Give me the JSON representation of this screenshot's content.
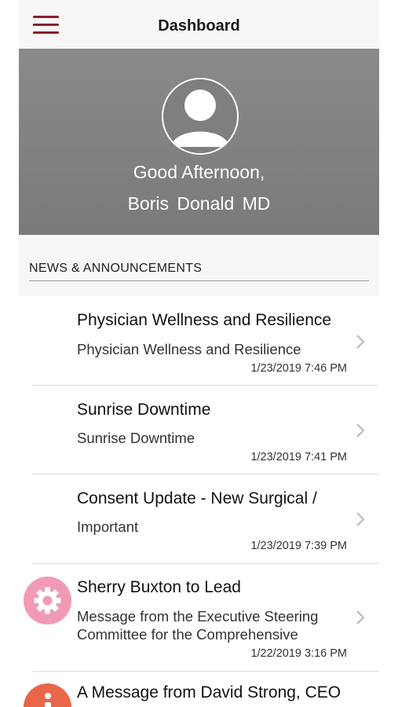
{
  "header": {
    "title": "Dashboard",
    "menu_icon": "hamburger-menu-icon",
    "accent_color": "#8a1f2d"
  },
  "profile": {
    "avatar_icon": "user-avatar-icon",
    "greeting": "Good Afternoon,",
    "name": "Boris  Donald  MD"
  },
  "news": {
    "section_title": "NEWS & ANNOUNCEMENTS",
    "items": [
      {
        "title": "Physician Wellness and Resilience",
        "subtitle": "Physician Wellness and Resilience",
        "date": "1/23/2019 7:46 PM",
        "icon": ""
      },
      {
        "title": "Sunrise Downtime",
        "subtitle": "Sunrise Downtime",
        "date": "1/23/2019 7:41 PM",
        "icon": ""
      },
      {
        "title": "Consent Update - New Surgical /",
        "subtitle": "Important",
        "date": "1/23/2019 7:39 PM",
        "icon": ""
      },
      {
        "title": "Sherry Buxton to Lead",
        "subtitle": "Message from the Executive Steering Committee for the Comprehensive",
        "date": "1/22/2019 3:16 PM",
        "icon": "gear-icon",
        "icon_color": "#f09bb3"
      },
      {
        "title": "A Message from David Strong, CEO",
        "subtitle": "",
        "date": "",
        "icon": "info-icon",
        "icon_color": "#e8674a"
      }
    ]
  }
}
